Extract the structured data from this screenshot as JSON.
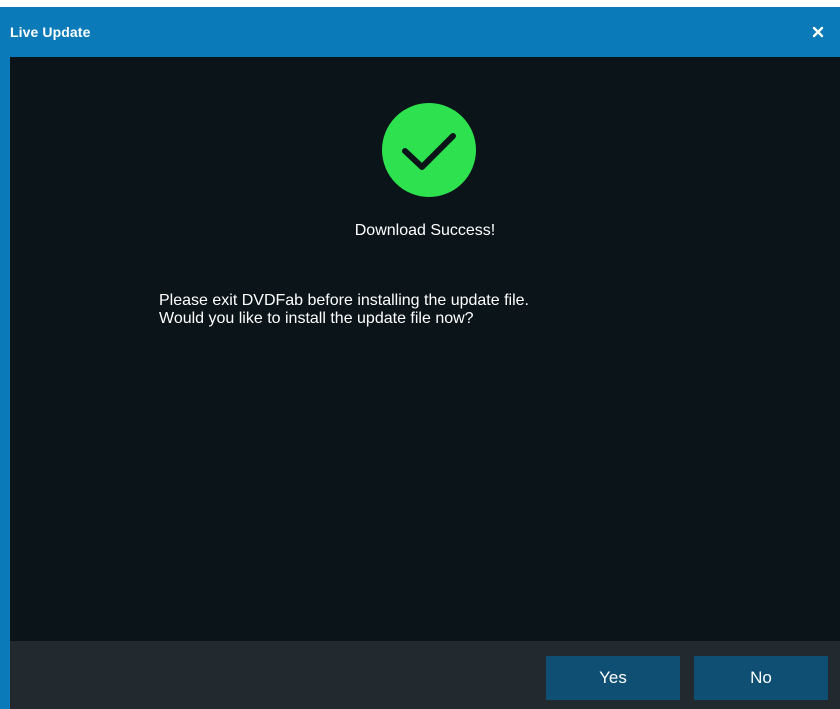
{
  "window": {
    "title": "Live Update",
    "close_icon": "close-icon"
  },
  "content": {
    "status_icon": "checkmark-circle-icon",
    "status_text": "Download Success!",
    "message_line1": "Please exit DVDFab before installing the update file.",
    "message_line2": "Would you like to install the update file now?"
  },
  "footer": {
    "yes_label": "Yes",
    "no_label": "No"
  },
  "colors": {
    "titlebar": "#0a7ab8",
    "background": "#0b1418",
    "footer": "#222a30",
    "button": "#0e4f73",
    "success_green": "#2ee24f"
  }
}
